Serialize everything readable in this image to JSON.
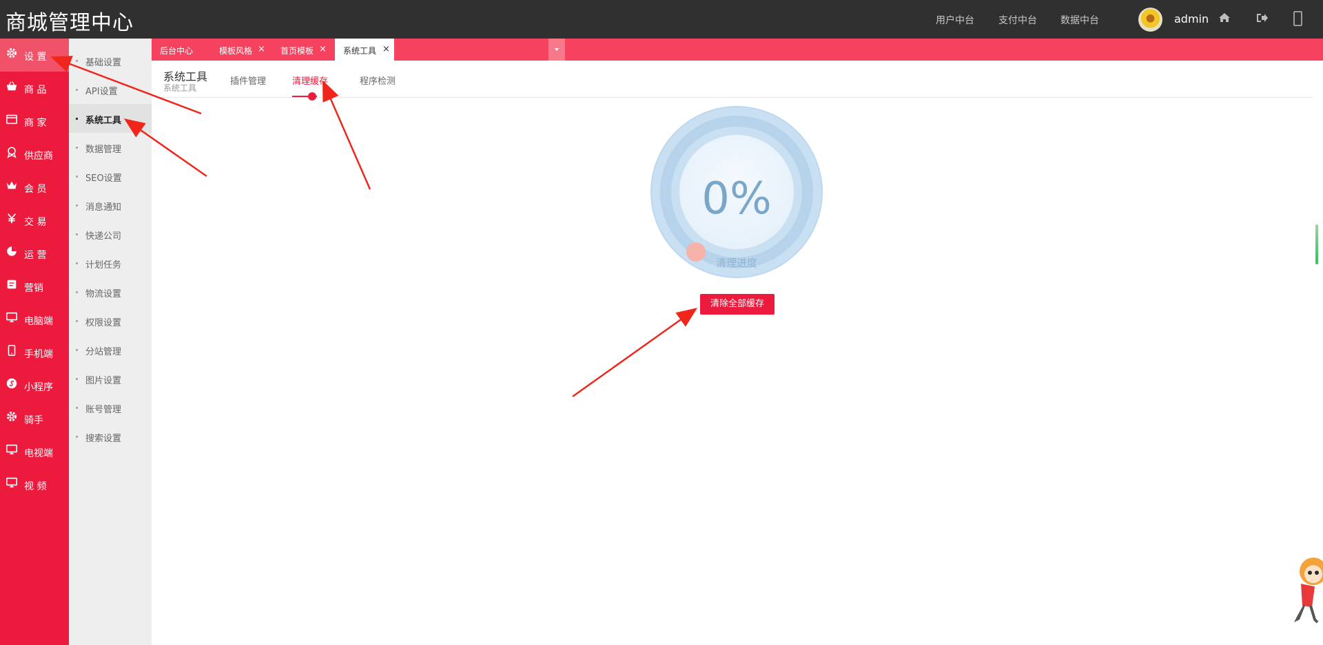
{
  "app": {
    "title": "商城管理中心"
  },
  "topnav": {
    "items": [
      "用户中台",
      "支付中台",
      "数据中台"
    ],
    "username": "admin"
  },
  "icons": {
    "home": "home-icon",
    "logout": "logout-icon",
    "phone": "mobile-icon"
  },
  "sidebar": {
    "items": [
      {
        "label": "设 置",
        "icon": "gear-icon",
        "active": true
      },
      {
        "label": "商 品",
        "icon": "basket-icon"
      },
      {
        "label": "商 家",
        "icon": "store-icon"
      },
      {
        "label": "供应商",
        "icon": "badge-icon"
      },
      {
        "label": "会 员",
        "icon": "crown-icon"
      },
      {
        "label": "交 易",
        "icon": "yen-icon"
      },
      {
        "label": "运 营",
        "icon": "pie-icon"
      },
      {
        "label": "营销",
        "icon": "tag-icon"
      },
      {
        "label": "电脑端",
        "icon": "monitor-icon"
      },
      {
        "label": "手机端",
        "icon": "mobile-icon"
      },
      {
        "label": "小程序",
        "icon": "miniapp-icon"
      },
      {
        "label": "骑手",
        "icon": "gear-icon"
      },
      {
        "label": "电视端",
        "icon": "monitor-icon"
      },
      {
        "label": "视 频",
        "icon": "monitor-icon"
      }
    ]
  },
  "subnav": {
    "items": [
      "基础设置",
      "API设置",
      "系统工具",
      "数据管理",
      "SEO设置",
      "消息通知",
      "快递公司",
      "计划任务",
      "物流设置",
      "权限设置",
      "分站管理",
      "图片设置",
      "账号管理",
      "搜索设置"
    ],
    "active_index": 2
  },
  "tabs": {
    "items": [
      {
        "label": "后台中心",
        "closable": false
      },
      {
        "label": "模板风格",
        "closable": true
      },
      {
        "label": "首页模板",
        "closable": true
      },
      {
        "label": "系统工具",
        "closable": true,
        "active": true
      }
    ],
    "close_glyph": "×"
  },
  "page": {
    "title": "系统工具",
    "subtitle": "系统工具",
    "subtabs": [
      "插件管理",
      "清理缓存",
      "程序检测"
    ],
    "active_subtab": 1
  },
  "cache": {
    "progress_text": "0%",
    "progress_value": 0,
    "progress_label": "清理进度",
    "clear_button": "清除全部缓存"
  },
  "colors": {
    "brand": "#ec1a3c",
    "topbar": "#303030",
    "tab_strip": "#f5435f",
    "gauge": "#c9e0f3"
  }
}
